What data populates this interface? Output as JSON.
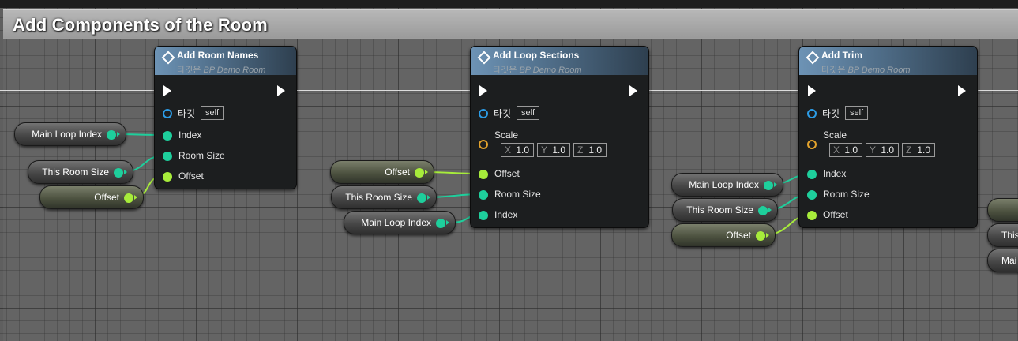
{
  "comment": {
    "title": "Add Components of the Room"
  },
  "nodes": [
    {
      "title": "Add Room Names",
      "target_prefix": "타깃은",
      "target_class": "BP Demo Room",
      "target_pin": "타깃",
      "self_label": "self",
      "pins": [
        "Index",
        "Room Size",
        "Offset"
      ]
    },
    {
      "title": "Add Loop Sections",
      "target_prefix": "타깃은",
      "target_class": "BP Demo Room",
      "target_pin": "타깃",
      "self_label": "self",
      "scale_label": "Scale",
      "scale": {
        "x": "1.0",
        "y": "1.0",
        "z": "1.0"
      },
      "pins": [
        "Offset",
        "Room Size",
        "Index"
      ]
    },
    {
      "title": "Add Trim",
      "target_prefix": "타깃은",
      "target_class": "BP Demo Room",
      "target_pin": "타깃",
      "self_label": "self",
      "scale_label": "Scale",
      "scale": {
        "x": "1.0",
        "y": "1.0",
        "z": "1.0"
      },
      "pins": [
        "Index",
        "Room Size",
        "Offset"
      ]
    }
  ],
  "axis_labels": {
    "x": "X",
    "y": "Y",
    "z": "Z"
  },
  "variables": {
    "main_loop_index": "Main Loop Index",
    "this_room_size": "This Room Size",
    "offset": "Offset",
    "this_cut": "This",
    "main_cut": "Mai"
  },
  "colors": {
    "integer_pin": "#1ecf9c",
    "float_pin": "#a7ec3b",
    "object_pin": "#2c9ce6",
    "vector_pin": "#e2a22c",
    "node_header": "#4f6d88"
  }
}
